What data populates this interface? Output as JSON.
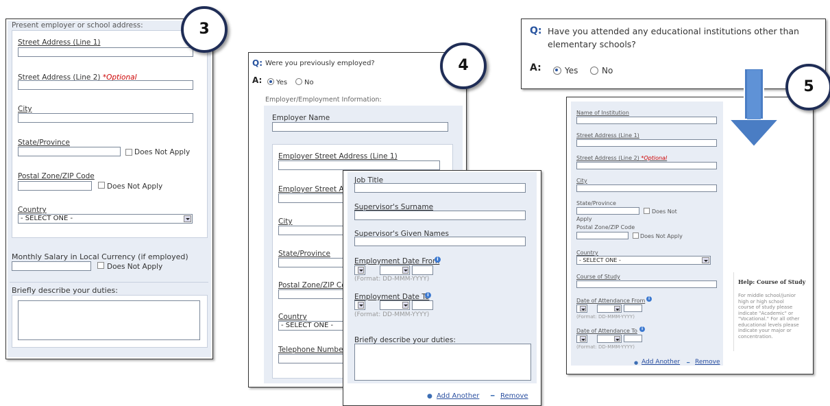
{
  "panel3": {
    "badge": "3",
    "section_title": "Present employer or school address:",
    "street1": "Street Address (Line 1)",
    "street2": "Street Address (Line 2)",
    "optional": "*Optional",
    "city": "City",
    "state": "State/Province",
    "does_not_apply": "Does Not Apply",
    "postal": "Postal Zone/ZIP Code",
    "country": "Country",
    "select_one": "- SELECT ONE -",
    "salary": "Monthly Salary in Local Currency (if employed)",
    "duties": "Briefly describe your duties:"
  },
  "panel4": {
    "badge": "4",
    "q_prefix": "Q:",
    "question": "Were you previously employed?",
    "a_prefix": "A:",
    "yes": "Yes",
    "no": "No",
    "section_title": "Employer/Employment Information:",
    "employer_name": "Employer Name",
    "street1": "Employer Street Address (Line 1)",
    "street2": "Employer Street Ad",
    "city": "City",
    "state": "State/Province",
    "postal": "Postal Zone/ZIP Co",
    "country": "Country",
    "select_one": "- SELECT ONE -",
    "telephone": "Telephone Number"
  },
  "panel4b": {
    "job_title": "Job Title",
    "sup_surname": "Supervisor's Surname",
    "sup_given": "Supervisor's Given Names",
    "date_from": "Employment Date From",
    "date_to": "Employment Date To",
    "format": "(Format: DD-MMM-YYYY)",
    "duties": "Briefly describe your duties:",
    "add_another": "Add Another",
    "remove": "Remove"
  },
  "panel5": {
    "badge": "5",
    "q_prefix": "Q:",
    "question_line1": "Have you attended any educational institutions other than",
    "question_line2": "elementary schools?",
    "a_prefix": "A:",
    "yes": "Yes",
    "no": "No",
    "institution": "Name of Institution",
    "street1": "Street Address (Line 1)",
    "street2": "Street Address (Line 2)",
    "optional": "*Optional",
    "city": "City",
    "state": "State/Province",
    "does_not": "Does Not",
    "apply": "Apply",
    "postal": "Postal Zone/ZIP Code",
    "does_not_apply": "Does Not Apply",
    "country": "Country",
    "select_one": "- SELECT ONE -",
    "course": "Course of Study",
    "attend_from": "Date of Attendance From",
    "attend_to": "Date of Attendance To",
    "format": "(Format: DD-MMM-YYYY)",
    "add_another": "Add Another",
    "remove": "Remove",
    "help_title": "Help: Course of Study",
    "help_text": "For middle school/junior high or high school course of study please indicate \"Academic\" or \"Vocational.\" For all other educational levels please indicate your major or concentration."
  },
  "colors": {
    "accent": "#2a55a0",
    "badge_ring": "#1f2d56",
    "arrow": "#4a7dc4",
    "panel_bg": "#e8edf5"
  }
}
